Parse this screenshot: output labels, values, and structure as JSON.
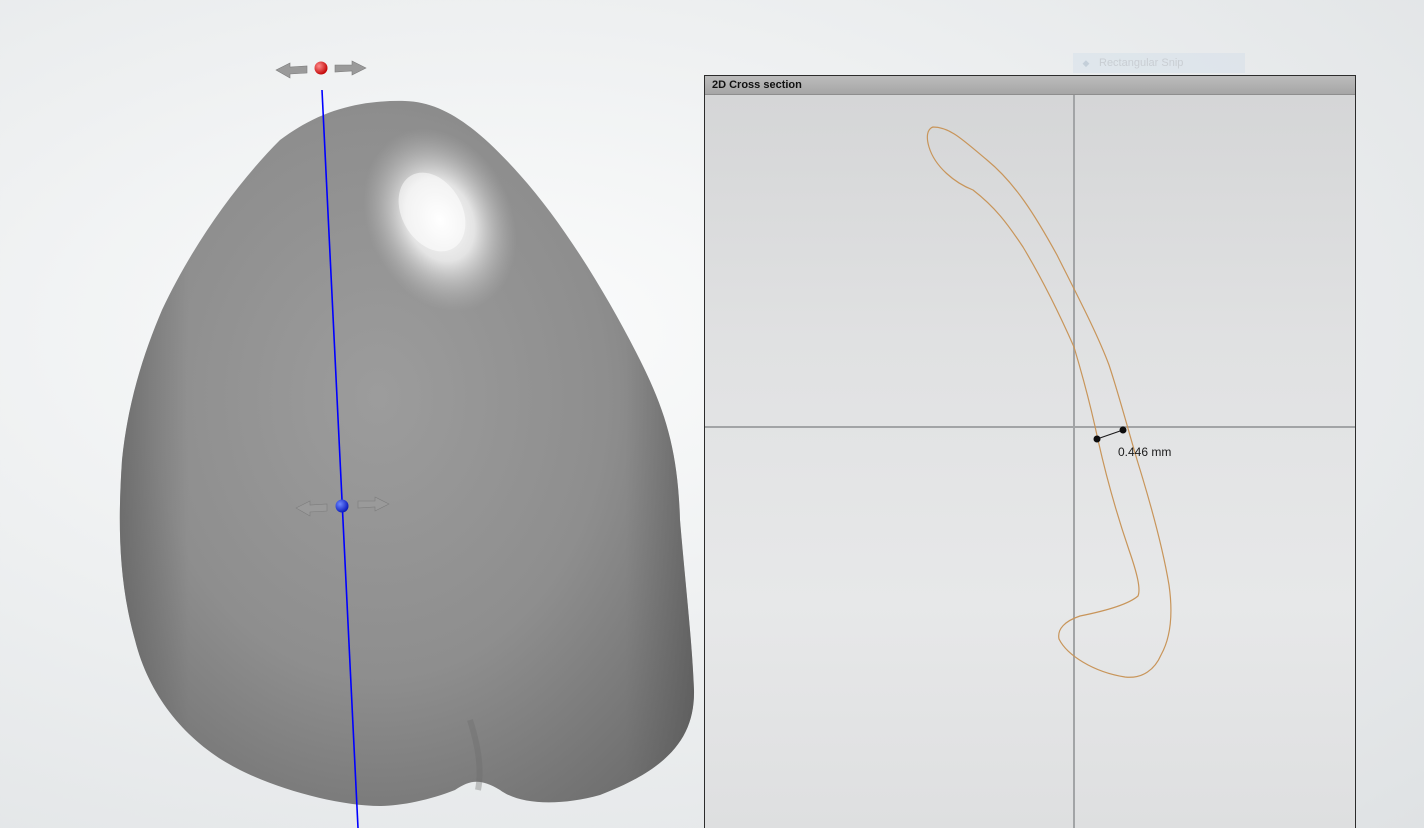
{
  "snip_overlay": {
    "icon": "snip-icon",
    "label": "Rectangular Snip"
  },
  "cross_section_panel": {
    "title": "2D Cross section",
    "measurement": {
      "value_label": "0.446 mm"
    }
  },
  "viewport_3d": {
    "model": "tooth-mesh",
    "section_line_color": "#0000ff",
    "top_handle_color": "#e00000",
    "center_handle_color": "#0a28e0",
    "arrow_color": "#9a9a9a"
  },
  "contour_color": "#c8955a"
}
